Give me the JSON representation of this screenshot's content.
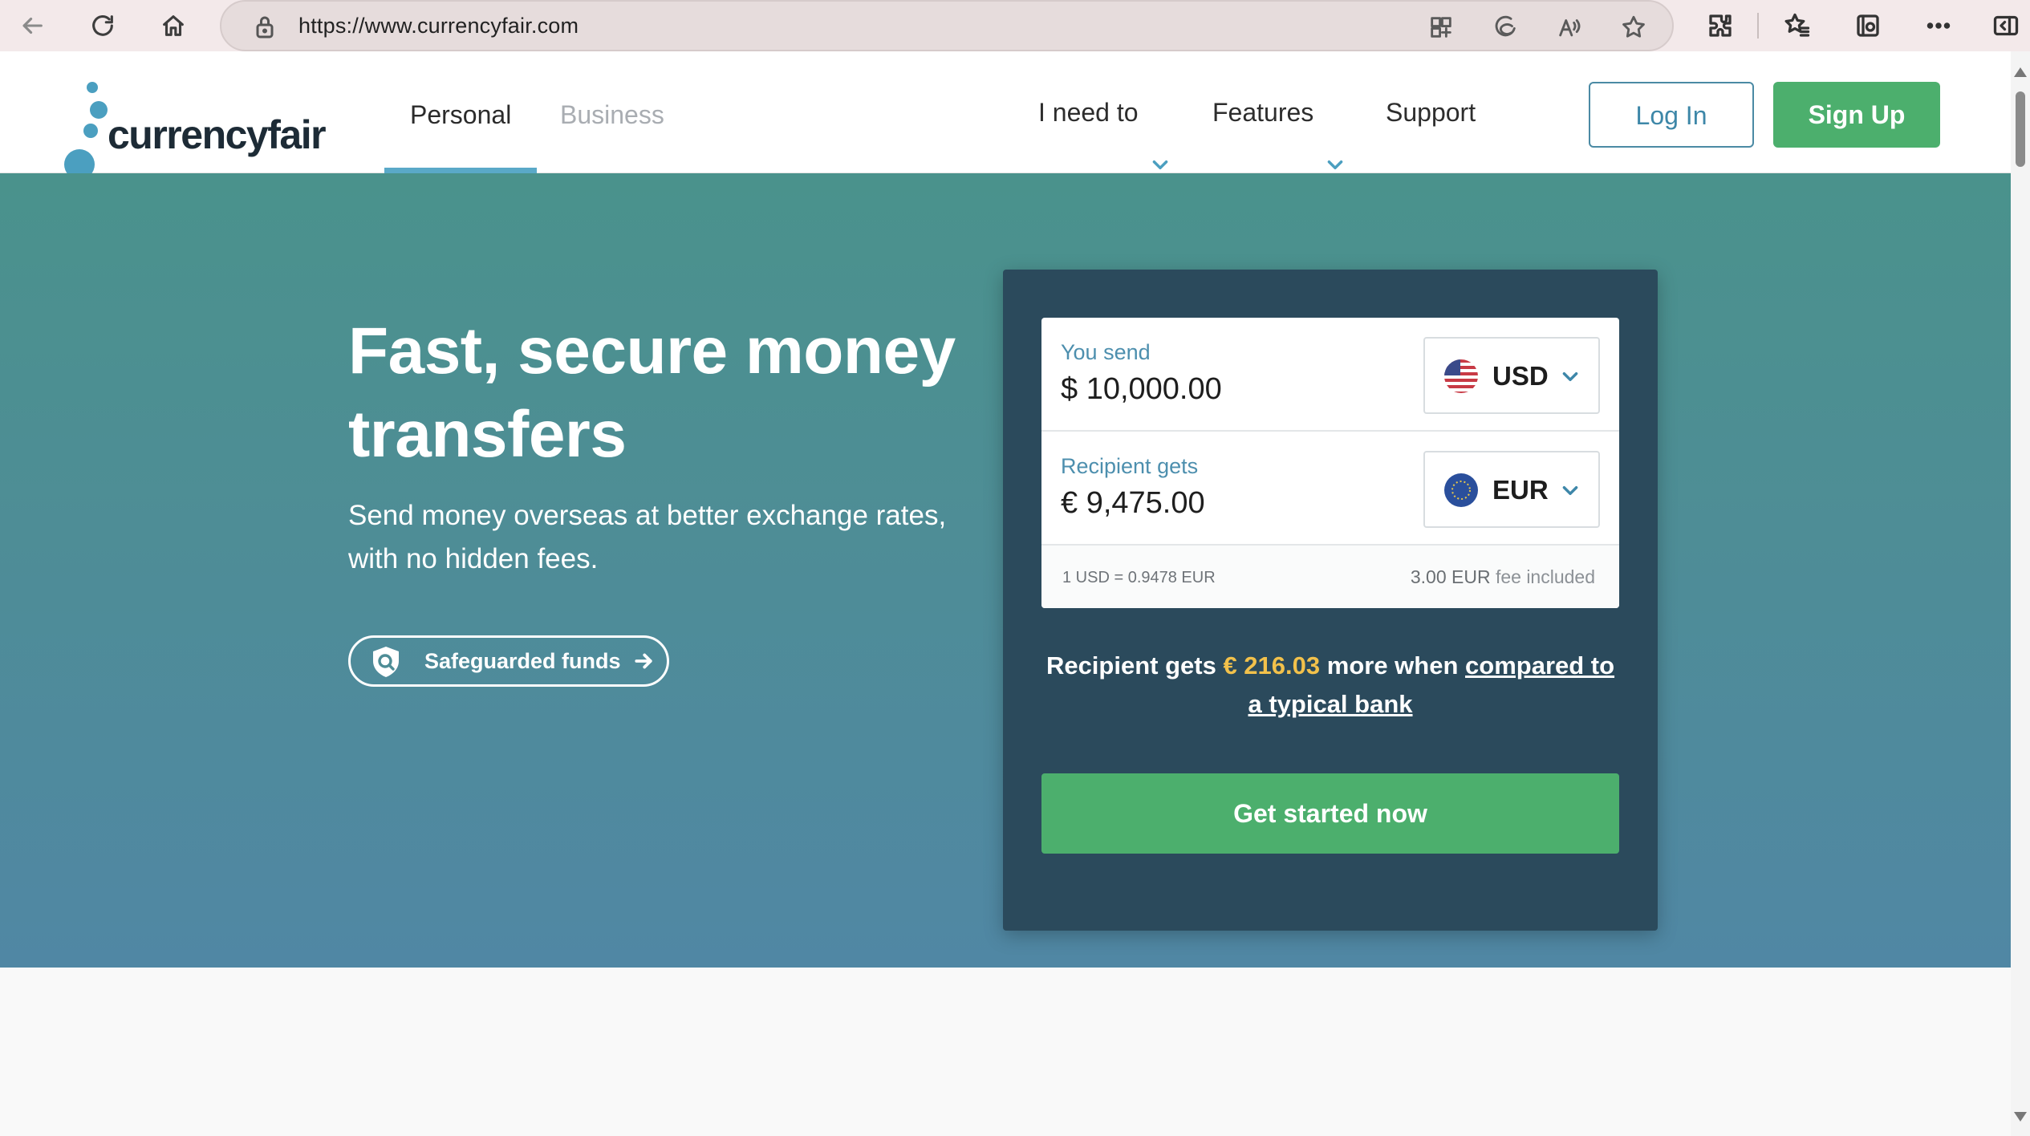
{
  "browser": {
    "url": "https://www.currencyfair.com"
  },
  "header": {
    "logo_text": "currencyfair",
    "tabs": [
      {
        "label": "Personal",
        "active": true
      },
      {
        "label": "Business",
        "active": false
      }
    ],
    "menu": [
      {
        "label": "I need to",
        "has_dropdown": true
      },
      {
        "label": "Features",
        "has_dropdown": true
      },
      {
        "label": "Support",
        "has_dropdown": false
      }
    ],
    "login_label": "Log In",
    "signup_label": "Sign Up"
  },
  "hero": {
    "title": "Fast, secure money transfers",
    "subtitle": "Send money overseas at better exchange rates, with no hidden fees.",
    "safeguard_label": "Safeguarded funds"
  },
  "converter": {
    "send_caption": "You send",
    "send_amount": "$ 10,000.00",
    "send_currency": "USD",
    "receive_caption": "Recipient gets",
    "receive_amount": "€ 9,475.00",
    "receive_currency": "EUR",
    "rate": "1 USD = 0.9478 EUR",
    "fee_amount": "3.00 EUR",
    "fee_suffix": "fee included",
    "savings_prefix": "Recipient gets",
    "savings_value": "€ 216.03",
    "savings_middle": "more when",
    "savings_link": "compared to a typical bank",
    "cta_label": "Get started now"
  },
  "colors": {
    "brand_green": "#4caf6d",
    "brand_blue": "#4b9fc0",
    "card_bg": "#2b4a5c",
    "highlight": "#f2c14b"
  }
}
